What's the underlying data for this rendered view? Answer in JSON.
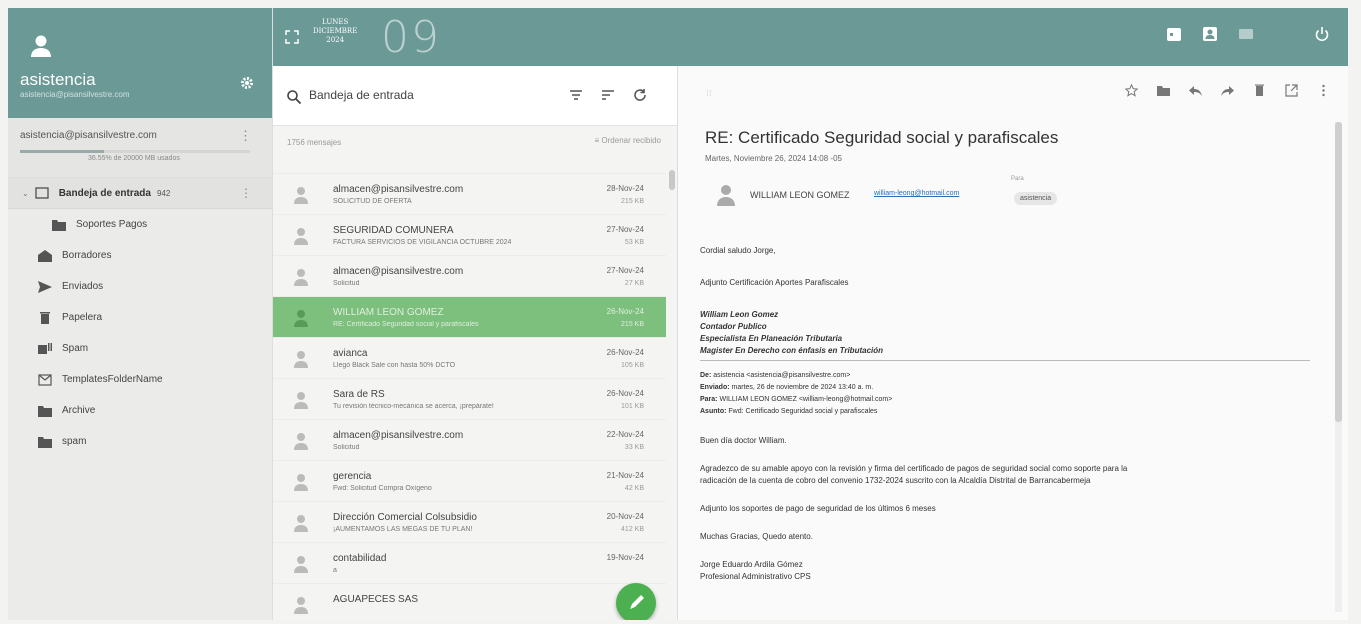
{
  "account": {
    "name": "asistencia",
    "email_small": "asistencia@pisansilvestre.com",
    "email": "asistencia@pisansilvestre.com",
    "quota": "36.55% de 20000 MB usados",
    "quota_fraction": 0.3655
  },
  "folders": {
    "inbox": {
      "label": "Bandeja de entrada",
      "count": "942"
    },
    "items": [
      {
        "label": "Soportes Pagos",
        "icon": "folder-icon",
        "sub": true
      },
      {
        "label": "Borradores",
        "icon": "drafts-icon"
      },
      {
        "label": "Enviados",
        "icon": "send-icon"
      },
      {
        "label": "Papelera",
        "icon": "trash-icon"
      },
      {
        "label": "Spam",
        "icon": "spam-icon"
      },
      {
        "label": "TemplatesFolderName",
        "icon": "template-icon"
      },
      {
        "label": "Archive",
        "icon": "folder-icon"
      },
      {
        "label": "spam",
        "icon": "folder-icon"
      }
    ]
  },
  "header": {
    "day": "LUNES",
    "month": "DICIEMBRE",
    "year": "2024",
    "date_number": "09",
    "accent": "#6a9996"
  },
  "list": {
    "search_placeholder": "Bandeja de entrada",
    "count_label": "1756 mensajes",
    "sort_label": "Ordenar recibido",
    "messages": [
      {
        "from": "",
        "subject": "",
        "date": "",
        "size": "",
        "top": true
      },
      {
        "from": "almacen@pisansilvestre.com",
        "subject": "SOLICITUD DE OFERTA",
        "date": "28-Nov-24",
        "size": "215 KB"
      },
      {
        "from": "SEGURIDAD COMUNERA",
        "subject": "FACTURA SERVICIOS DE VIGILANCIA OCTUBRE 2024",
        "date": "27-Nov-24",
        "size": "53 KB"
      },
      {
        "from": "almacen@pisansilvestre.com",
        "subject": "Solicitud",
        "date": "27-Nov-24",
        "size": "27 KB"
      },
      {
        "from": "WILLIAM LEON GOMEZ",
        "subject": "RE: Certificado Seguridad social y parafiscales",
        "date": "26-Nov-24",
        "size": "215 KB",
        "selected": true
      },
      {
        "from": "avianca",
        "subject": "Llegó Black Sale con hasta 50% DCTO",
        "date": "26-Nov-24",
        "size": "105 KB"
      },
      {
        "from": "Sara de RS",
        "subject": "Tu revisión técnico-mecánica se acerca, ¡prepárate!",
        "date": "26-Nov-24",
        "size": "101 KB"
      },
      {
        "from": "almacen@pisansilvestre.com",
        "subject": "Solicitud",
        "date": "22-Nov-24",
        "size": "33 KB"
      },
      {
        "from": "gerencia",
        "subject": "Fwd: Solicitud Compra Oxígeno",
        "date": "21-Nov-24",
        "size": "42 KB"
      },
      {
        "from": "Dirección Comercial Colsubsidio",
        "subject": "¡AUMENTAMOS LAS MEGAS DE TU PLAN!",
        "date": "20-Nov-24",
        "size": "412 KB"
      },
      {
        "from": "contabilidad",
        "subject": "a",
        "date": "19-Nov-24",
        "size": ""
      },
      {
        "from": "AGUAPECES SAS",
        "subject": "",
        "date": "",
        "size": ""
      }
    ]
  },
  "reader": {
    "subject": "RE: Certificado Seguridad social y parafiscales",
    "date": "Martes, Noviembre 26, 2024 14:08 -05",
    "from_name": "WILLIAM LEON GOMEZ",
    "from_addr": "william-leong@hotmail.com",
    "to_label": "Para",
    "to": "asistencia",
    "greeting": "Cordial saludo Jorge,",
    "line1": "Adjunto Certificación Aportes Parafiscales",
    "sig1": "William Leon Gomez",
    "sig2": "Contador Publico",
    "sig3": "Especialista En Planeación Tributaria",
    "sig4": "Magister En Derecho con énfasis en Tributación",
    "fw_de_lbl": "De:",
    "fw_de": "asistencia <asistencia@pisansilvestre.com>",
    "fw_env_lbl": "Enviado:",
    "fw_env": "martes, 26 de noviembre de 2024 13:40 a. m.",
    "fw_para_lbl": "Para:",
    "fw_para": "WILLIAM LEON GOMEZ <william-leong@hotmail.com>",
    "fw_asunto_lbl": "Asunto:",
    "fw_asunto": "Fwd: Certificado Seguridad social y parafiscales",
    "p1": "Buen día doctor William.",
    "p2a": "Agradezco de su amable apoyo con la revisión y firma del certificado de pagos de seguridad social como soporte para la",
    "p2b": "radicación de la cuenta de cobro del convenio 1732-2024 suscrito con la Alcaldía Distrital de Barrancabermeja",
    "p3": "Adjunto los soportes de pago de seguridad de los últimos 6 meses",
    "p4": "Muchas Gracias, Quedo atento.",
    "s1": "Jorge Eduardo Ardila Gómez",
    "s2": "Profesional Administrativo CPS"
  }
}
